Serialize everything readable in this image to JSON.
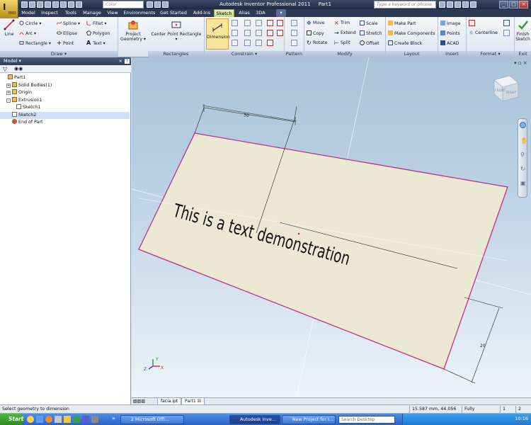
{
  "app": {
    "title": "Autodesk Inventor Professional 2011",
    "document": "Part1",
    "color_placeholder": "Color",
    "search_placeholder": "Type a keyword or phrase",
    "logo_letter": "I",
    "logo_sub": "PRO"
  },
  "tabs": [
    "Model",
    "Inspect",
    "Tools",
    "Manage",
    "View",
    "Environments",
    "Get Started",
    "Add-Ins",
    "Sketch",
    "Alias",
    "3DA"
  ],
  "active_tab": "Sketch",
  "ribbon": {
    "draw": {
      "title": "Draw",
      "line": "Line",
      "circle": "Circle",
      "arc": "Arc",
      "rectangle": "Rectangle",
      "spline": "Spline",
      "ellipse": "Ellipse",
      "point": "Point",
      "fillet": "Fillet",
      "polygon": "Polygon",
      "text": "Text",
      "project_geometry": "Project Geometry"
    },
    "rectangles": {
      "title": "Rectangles",
      "center_point": "Center Point Rectangle"
    },
    "constrain": {
      "title": "Constrain",
      "dimension": "Dimension"
    },
    "pattern": {
      "title": "Pattern"
    },
    "modify": {
      "title": "Modify",
      "move": "Move",
      "copy": "Copy",
      "rotate": "Rotate",
      "trim": "Trim",
      "extend": "Extend",
      "split": "Split",
      "scale": "Scale",
      "stretch": "Stretch",
      "offset": "Offset"
    },
    "layout": {
      "title": "Layout",
      "make_part": "Make Part",
      "make_components": "Make Components",
      "create_block": "Create Block"
    },
    "insert": {
      "title": "Insert",
      "image": "Image",
      "points": "Points",
      "acad": "ACAD"
    },
    "format": {
      "title": "Format",
      "centerline": "Centerline"
    },
    "exit": {
      "title": "Exit",
      "finish": "Finish",
      "finish2": "Sketch"
    }
  },
  "browser": {
    "title": "Model",
    "items": [
      {
        "label": "Part1",
        "level": 0,
        "expander": ""
      },
      {
        "label": "Solid Bodies(1)",
        "level": 1,
        "expander": "+"
      },
      {
        "label": "Origin",
        "level": 1,
        "expander": "+"
      },
      {
        "label": "Extrusion1",
        "level": 1,
        "expander": "-"
      },
      {
        "label": "Sketch1",
        "level": 2,
        "expander": ""
      },
      {
        "label": "Sketch2",
        "level": 1,
        "expander": "",
        "selected": true
      },
      {
        "label": "End of Part",
        "level": 1,
        "expander": ""
      }
    ]
  },
  "viewport": {
    "sketch_text": "This is a text demonstration",
    "dim_top": "50",
    "dim_right": "20",
    "viewcube_front": "FRONT",
    "viewcube_right": "RIGHT",
    "axis_x": "X",
    "axis_y": "Y",
    "axis_z": "Z"
  },
  "doc_tabs": [
    "facia.ipt",
    "Part1"
  ],
  "status": {
    "message": "Select geometry to dimension",
    "coords": "15.587 mm, 44.056 mm",
    "constraint": "Fully Constrained",
    "n1": "1",
    "n2": "2"
  },
  "taskbar": {
    "start": "Start",
    "items": [
      "2 Microsoft Offi...",
      "Autodesk Inve...",
      "New Project for I..."
    ],
    "active_index": 1,
    "search": "Search Desktop",
    "clock": "10:16",
    "chevron": "»"
  },
  "colors": {
    "accent": "#c6d977",
    "sketch_fill": "#ebe8d4",
    "sketch_edge": "#c0308a",
    "viewport_top": "#a9c3d9"
  }
}
